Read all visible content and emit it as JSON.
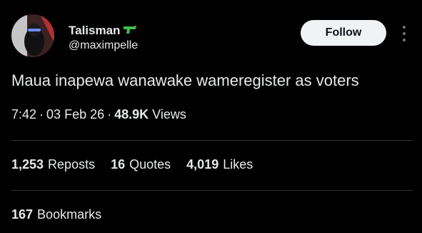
{
  "author": {
    "display_name": "Talisman",
    "badge_icon": "green-pistol-emoji",
    "handle": "@maximpelle"
  },
  "follow_label": "Follow",
  "tweet": {
    "text": "Maua inapewa wanawake wameregister as voters"
  },
  "meta": {
    "time": "7:42",
    "date": "03 Feb 26",
    "views_count": "48.9K",
    "views_label": "Views"
  },
  "stats": {
    "reposts_count": "1,253",
    "reposts_label": "Reposts",
    "quotes_count": "16",
    "quotes_label": "Quotes",
    "likes_count": "4,019",
    "likes_label": "Likes",
    "bookmarks_count": "167",
    "bookmarks_label": "Bookmarks"
  },
  "colors": {
    "background": "#000000",
    "text": "#e7e9ea",
    "divider": "#2f3336",
    "button_bg": "#eff3f4",
    "button_text": "#0f1419",
    "badge": "#3fbf4f"
  }
}
